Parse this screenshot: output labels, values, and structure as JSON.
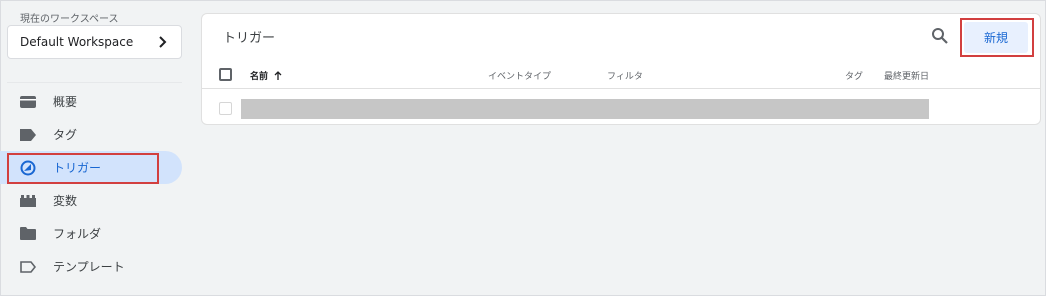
{
  "workspace": {
    "label": "現在のワークスペース",
    "name": "Default Workspace"
  },
  "sidebar": {
    "items": [
      {
        "label": "概要",
        "icon": "overview-icon"
      },
      {
        "label": "タグ",
        "icon": "tag-icon"
      },
      {
        "label": "トリガー",
        "icon": "trigger-icon",
        "active": true
      },
      {
        "label": "変数",
        "icon": "variables-icon"
      },
      {
        "label": "フォルダ",
        "icon": "folder-icon"
      },
      {
        "label": "テンプレート",
        "icon": "template-icon"
      }
    ]
  },
  "main": {
    "title": "トリガー",
    "new_button": "新規",
    "columns": {
      "name": "名前",
      "event_type": "イベントタイプ",
      "filter": "フィルタ",
      "tag": "タグ",
      "last_edited": "最終更新日"
    }
  },
  "colors": {
    "accent": "#1967d2",
    "active_bg": "#d2e3fc",
    "highlight": "#d23f3f"
  }
}
